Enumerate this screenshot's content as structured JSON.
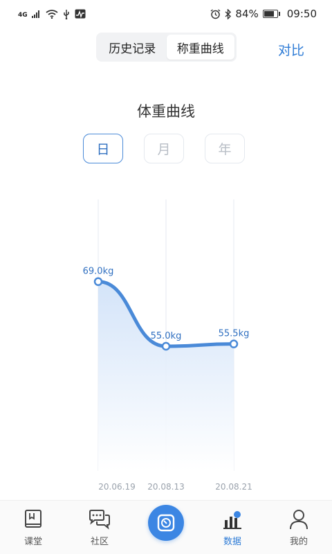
{
  "status_bar": {
    "network": "4G",
    "battery_text": "84%",
    "battery_level": 0.84,
    "time": "09:50"
  },
  "top_tabs": [
    {
      "label": "历史记录",
      "active": false
    },
    {
      "label": "称重曲线",
      "active": true
    }
  ],
  "compare_label": "对比",
  "chart_title": "体重曲线",
  "periods": [
    {
      "label": "日",
      "active": true
    },
    {
      "label": "月",
      "active": false
    },
    {
      "label": "年",
      "active": false
    }
  ],
  "chart_data": {
    "type": "area",
    "title": "体重曲线",
    "x": [
      "20.06.19",
      "20.08.13",
      "20.08.21"
    ],
    "values": [
      69.0,
      55.0,
      55.5
    ],
    "data_labels": [
      "69.0kg",
      "55.0kg",
      "55.5kg"
    ],
    "unit": "kg",
    "grid": true,
    "colors": {
      "line": "#4a8ad8",
      "fill_top": "#cfe1f8",
      "fill_bottom": "#ffffff",
      "label": "#2f6fc0"
    }
  },
  "nav": [
    {
      "label": "课堂",
      "icon": "book-icon",
      "active": false
    },
    {
      "label": "社区",
      "icon": "chat-icon",
      "active": false
    },
    {
      "label": "",
      "icon": "scale-icon",
      "active": false,
      "center": true
    },
    {
      "label": "数据",
      "icon": "bar-chart-icon",
      "active": true
    },
    {
      "label": "我的",
      "icon": "user-icon",
      "active": false
    }
  ],
  "colors": {
    "accent": "#2f7cd6"
  }
}
